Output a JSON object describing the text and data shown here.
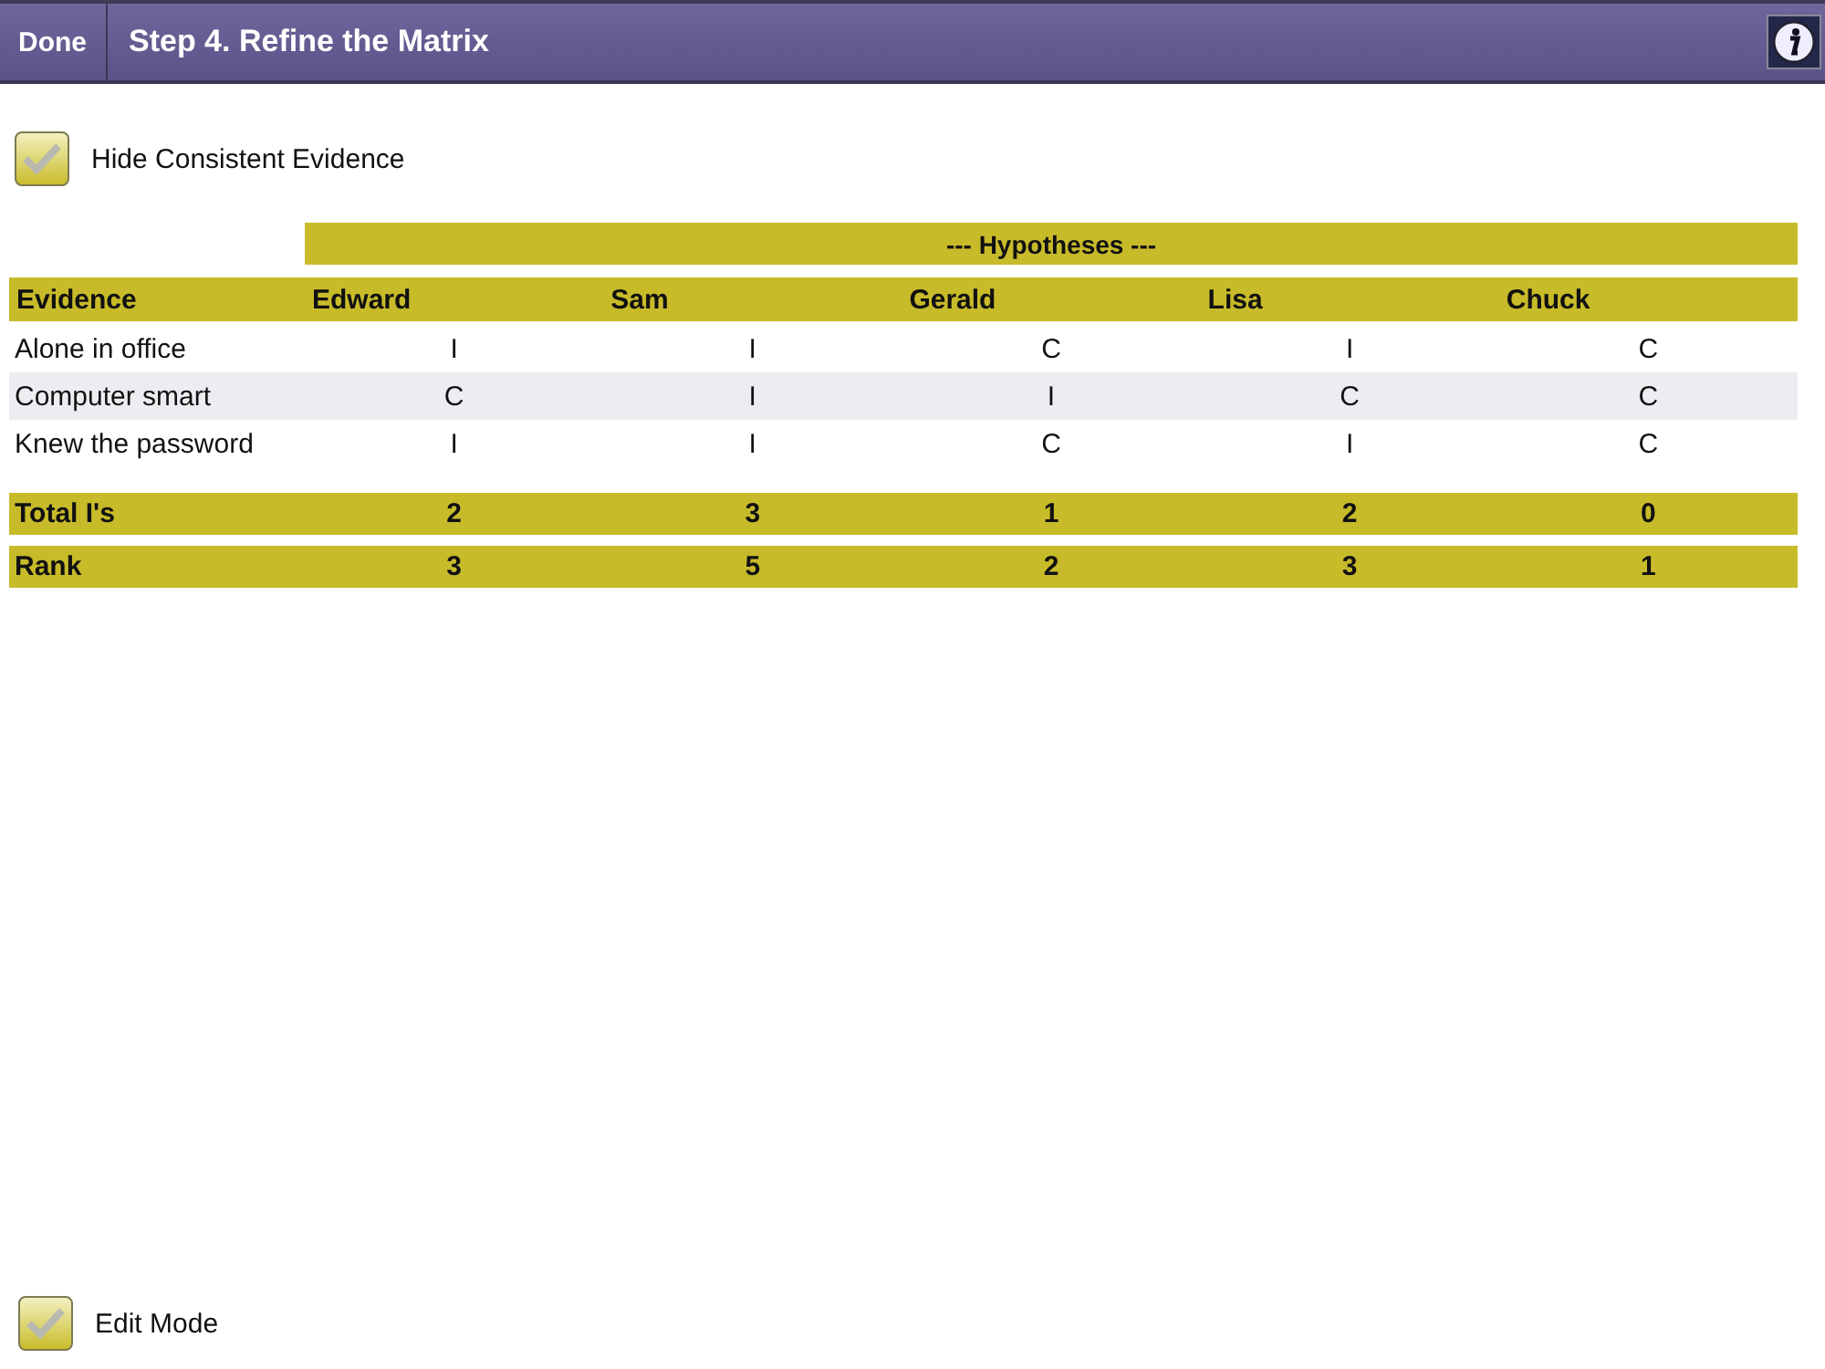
{
  "toolbar": {
    "done_button": "Done",
    "title": "Step 4. Refine the Matrix"
  },
  "hide_consistent": {
    "label": "Hide Consistent Evidence",
    "checked": false
  },
  "matrix": {
    "group_heading": "--- Hypotheses ---",
    "columns": [
      "Evidence",
      "Edward",
      "Sam",
      "Gerald",
      "Lisa",
      "Chuck"
    ],
    "rows": [
      {
        "evidence": "Alone in office",
        "cells": [
          "I",
          "I",
          "C",
          "I",
          "C"
        ],
        "selected": false
      },
      {
        "evidence": "Computer smart",
        "cells": [
          "C",
          "I",
          "I",
          "C",
          "C"
        ],
        "selected": true
      },
      {
        "evidence": "Knew the password",
        "cells": [
          "I",
          "I",
          "C",
          "I",
          "C"
        ],
        "selected": false
      }
    ],
    "totals": [
      {
        "label": "Total I's",
        "cells": [
          "2",
          "3",
          "1",
          "2",
          "0"
        ]
      },
      {
        "label": "Rank",
        "cells": [
          "3",
          "5",
          "2",
          "3",
          "1"
        ]
      }
    ]
  },
  "edit_mode": {
    "label": "Edit Mode",
    "checked": false
  }
}
